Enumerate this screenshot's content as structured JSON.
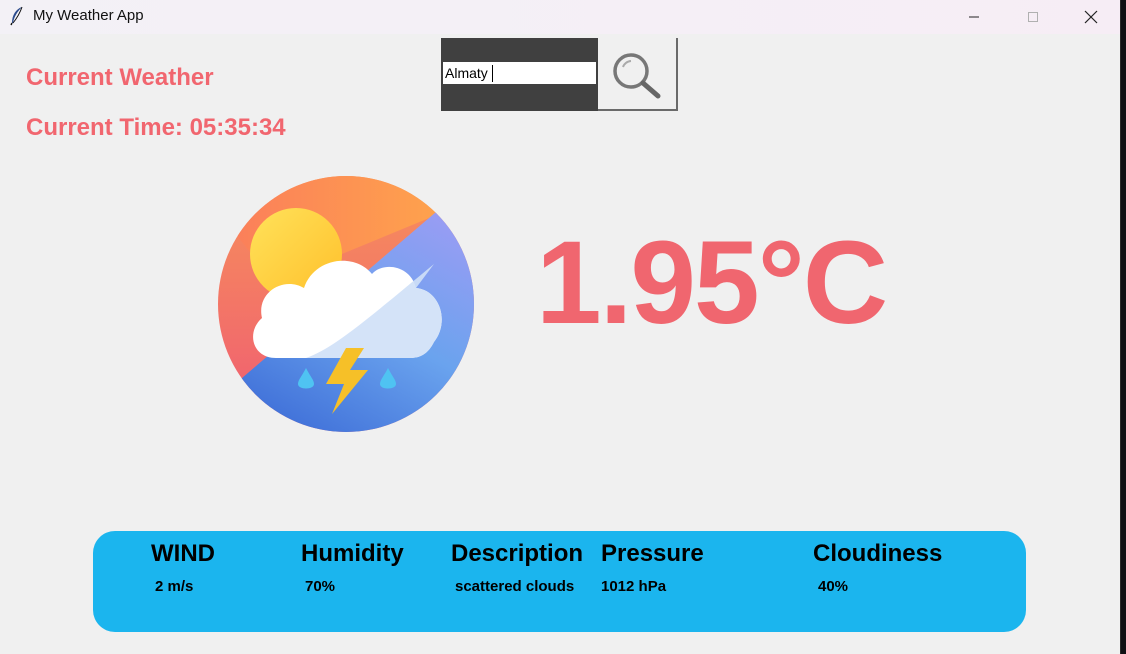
{
  "window": {
    "title": "My Weather App"
  },
  "header": {
    "title": "Current Weather",
    "time_label": "Current Time: 05:35:34"
  },
  "search": {
    "value": "Almaty",
    "icon": "magnifier-icon"
  },
  "weather": {
    "icon": "thunderstorm-cloud-sun-icon",
    "temperature": "1.95°C"
  },
  "details": [
    {
      "label": "WIND",
      "value": "2 m/s"
    },
    {
      "label": "Humidity",
      "value": "70%"
    },
    {
      "label": "Description",
      "value": "scattered clouds"
    },
    {
      "label": "Pressure",
      "value": "1012 hPa"
    },
    {
      "label": "Cloudiness",
      "value": "40%"
    }
  ],
  "colors": {
    "accent": "#f1666f",
    "info_bar": "#1bb5ee",
    "search_frame": "#404040",
    "background": "#f0f0f0"
  }
}
